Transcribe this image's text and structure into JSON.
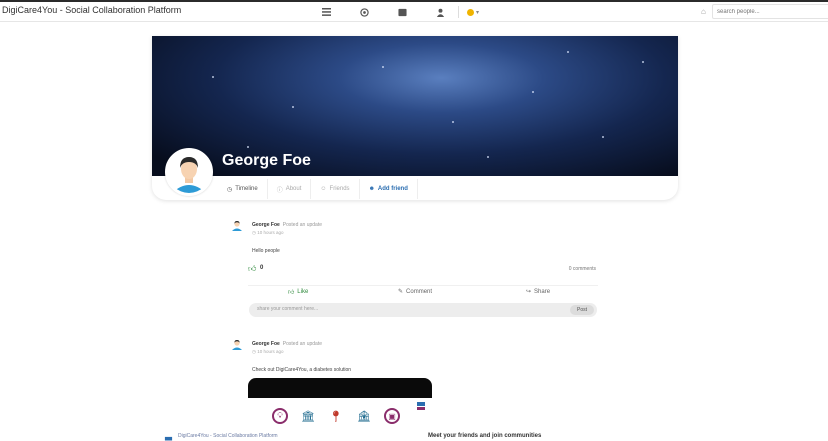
{
  "app": {
    "title": "DigiCare4You - Social Collaboration Platform",
    "accent_color": "#2a6db0",
    "status_color": "#f0b400"
  },
  "topbar": {
    "nav_icons": [
      "list-icon",
      "globe-icon",
      "grid-icon",
      "user-icon"
    ],
    "status_caret": "▾",
    "search_placeholder": "search people..."
  },
  "profile": {
    "name": "George Foe",
    "tabs": [
      {
        "label": "Timeline",
        "icon": "clock-icon"
      },
      {
        "label": "About",
        "icon": "info-icon"
      },
      {
        "label": "Friends",
        "icon": "friends-icon"
      },
      {
        "label": "Add friend",
        "icon": "add-user-icon"
      }
    ]
  },
  "posts": [
    {
      "author": "George Foe",
      "action": "Posted an update",
      "time": "10 hours ago",
      "body": "Hello people",
      "likes": "0",
      "comments": "0 comments",
      "like_label": "Like",
      "comment_label": "Comment",
      "share_label": "Share",
      "comment_placeholder": "share your comment here...",
      "post_button": "Post"
    },
    {
      "author": "George Foe",
      "action": "Posted an update",
      "time": "10 hours ago",
      "body": "Check out DigiCare4You, a diabetes solution"
    }
  ],
  "footer": {
    "brand": "DigiCare4You - Social Collaboration Platform",
    "tagline": "Meet your friends and join communities"
  }
}
